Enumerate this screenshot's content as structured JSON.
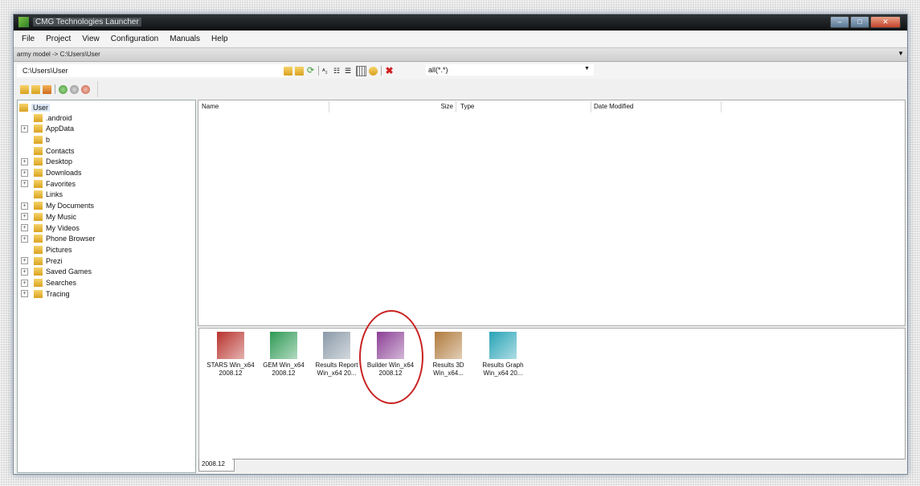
{
  "window": {
    "title": "CMG Technologies Launcher"
  },
  "menu": [
    "File",
    "Project",
    "View",
    "Configuration",
    "Manuals",
    "Help"
  ],
  "pathbar": {
    "text": "army model -> C:\\Users\\User"
  },
  "address": {
    "value": "C:\\Users\\User"
  },
  "filter": {
    "value": "all(*.*)"
  },
  "tree": {
    "root": "User",
    "items": [
      {
        "label": ".android",
        "expandable": false,
        "icon": "folder-icon"
      },
      {
        "label": "AppData",
        "expandable": true,
        "icon": "folder-icon"
      },
      {
        "label": "b",
        "expandable": false,
        "icon": "folder-icon"
      },
      {
        "label": "Contacts",
        "expandable": false,
        "icon": "contacts-folder-icon"
      },
      {
        "label": "Desktop",
        "expandable": true,
        "icon": "desktop-folder-icon"
      },
      {
        "label": "Downloads",
        "expandable": true,
        "icon": "downloads-folder-icon"
      },
      {
        "label": "Favorites",
        "expandable": true,
        "icon": "favorites-folder-icon"
      },
      {
        "label": "Links",
        "expandable": false,
        "icon": "links-folder-icon"
      },
      {
        "label": "My Documents",
        "expandable": true,
        "icon": "documents-folder-icon"
      },
      {
        "label": "My Music",
        "expandable": true,
        "icon": "music-folder-icon"
      },
      {
        "label": "My Videos",
        "expandable": true,
        "icon": "videos-folder-icon"
      },
      {
        "label": "Phone Browser",
        "expandable": true,
        "icon": "folder-icon"
      },
      {
        "label": "Pictures",
        "expandable": false,
        "icon": "folder-icon"
      },
      {
        "label": "Prezi",
        "expandable": true,
        "icon": "folder-icon"
      },
      {
        "label": "Saved Games",
        "expandable": true,
        "icon": "saved-games-folder-icon"
      },
      {
        "label": "Searches",
        "expandable": true,
        "icon": "searches-folder-icon"
      },
      {
        "label": "Tracing",
        "expandable": true,
        "icon": "folder-icon"
      }
    ]
  },
  "filelist": {
    "columns": [
      "Name",
      "Size",
      "Type",
      "Date Modified"
    ]
  },
  "launcher": {
    "apps": [
      {
        "line1": "STARS Win_x64",
        "line2": "2008.12",
        "color": "#b8322c",
        "icon": "stars-app-icon"
      },
      {
        "line1": "GEM Win_x64",
        "line2": "2008.12",
        "color": "#2f9a55",
        "icon": "gem-app-icon"
      },
      {
        "line1": "Results Report",
        "line2": "Win_x64 20...",
        "color": "#8a9aa8",
        "icon": "results-report-app-icon"
      },
      {
        "line1": "Builder Win_x64",
        "line2": "2008.12",
        "color": "#8b3f95",
        "icon": "builder-app-icon"
      },
      {
        "line1": "Results 3D",
        "line2": "Win_x64...",
        "color": "#b07a3c",
        "icon": "results-3d-app-icon"
      },
      {
        "line1": "Results Graph",
        "line2": "Win_x64 20...",
        "color": "#27a3b6",
        "icon": "results-graph-app-icon"
      }
    ],
    "highlight_color": "#c92222"
  },
  "tab": {
    "label": "2008.12"
  }
}
